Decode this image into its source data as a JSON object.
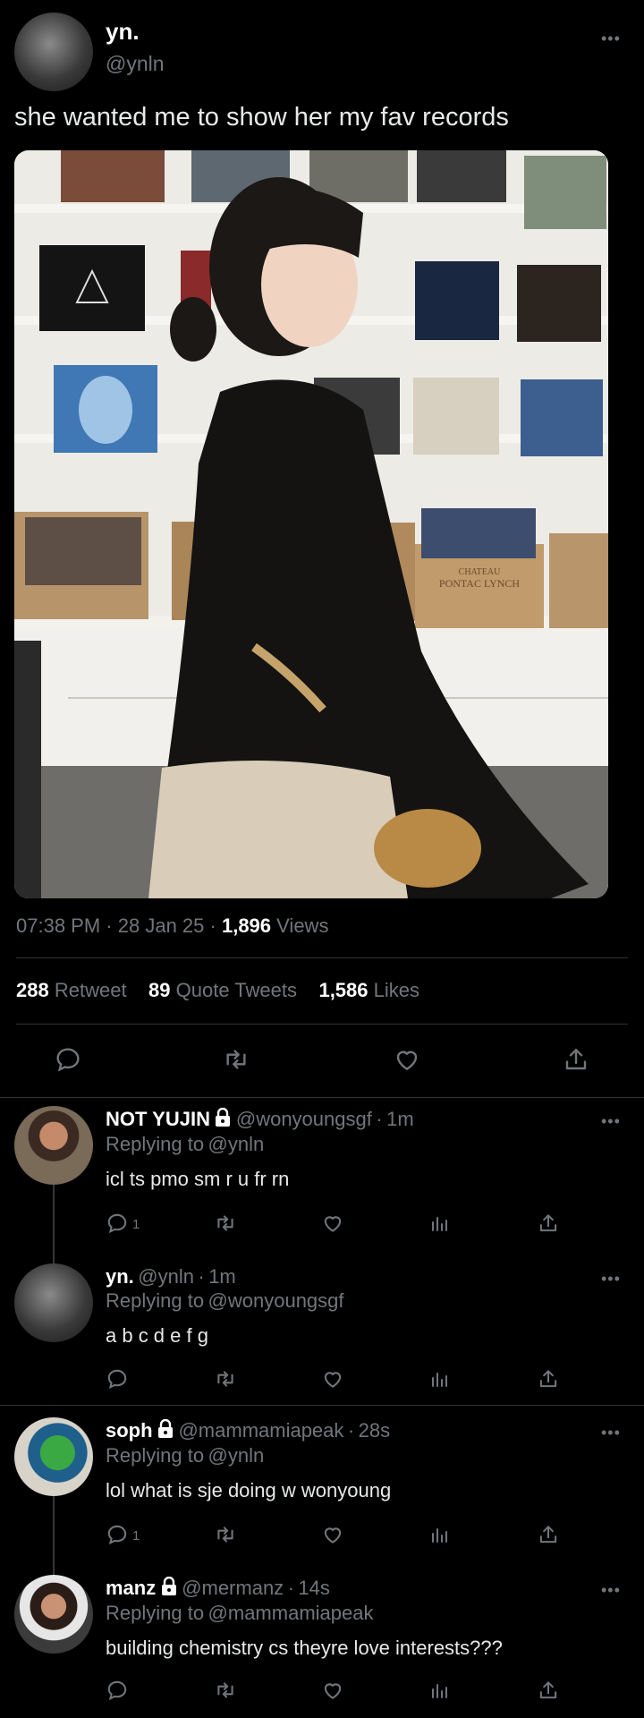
{
  "tweet": {
    "author_name": "yn.",
    "author_handle": "@ynln",
    "text": "she wanted me to show her my fav records",
    "time": "07:38 PM",
    "date": "28 Jan 25",
    "views_count": "1,896",
    "views_label": "Views",
    "retweet_count": "288",
    "retweet_label": "Retweet",
    "quote_count": "89",
    "quote_label": "Quote Tweets",
    "like_count": "1,586",
    "like_label": "Likes",
    "photo": {
      "album_text_1": "CHATEAU",
      "album_text_2": "PONTAC LYNCH"
    }
  },
  "replies": [
    {
      "name": "NOT YUJIN",
      "handle": "@wonyoungsgf",
      "time": "1m",
      "replying_label": "Replying to",
      "replying_to": "@ynln",
      "text": "icl ts pmo sm r u fr rn",
      "reply_count": "1"
    },
    {
      "name": "yn.",
      "handle": "@ynln",
      "time": "1m",
      "replying_label": "Replying to",
      "replying_to": "@wonyoungsgf",
      "text": "a b c d e f g",
      "reply_count": ""
    },
    {
      "name": "soph",
      "handle": "@mammamiapeak",
      "time": "28s",
      "replying_label": "Replying to",
      "replying_to": "@ynln",
      "text": "lol what is sje doing w wonyoung",
      "reply_count": "1"
    },
    {
      "name": "manz",
      "handle": "@mermanz",
      "time": "14s",
      "replying_label": "Replying to",
      "replying_to": "@mammamiapeak",
      "text": "building chemistry cs theyre love interests???",
      "reply_count": ""
    }
  ],
  "separator": "·",
  "colors": {
    "accent": "#1d9bf0",
    "muted": "#71767b",
    "background": "#000000",
    "divider": "#2f3336"
  }
}
